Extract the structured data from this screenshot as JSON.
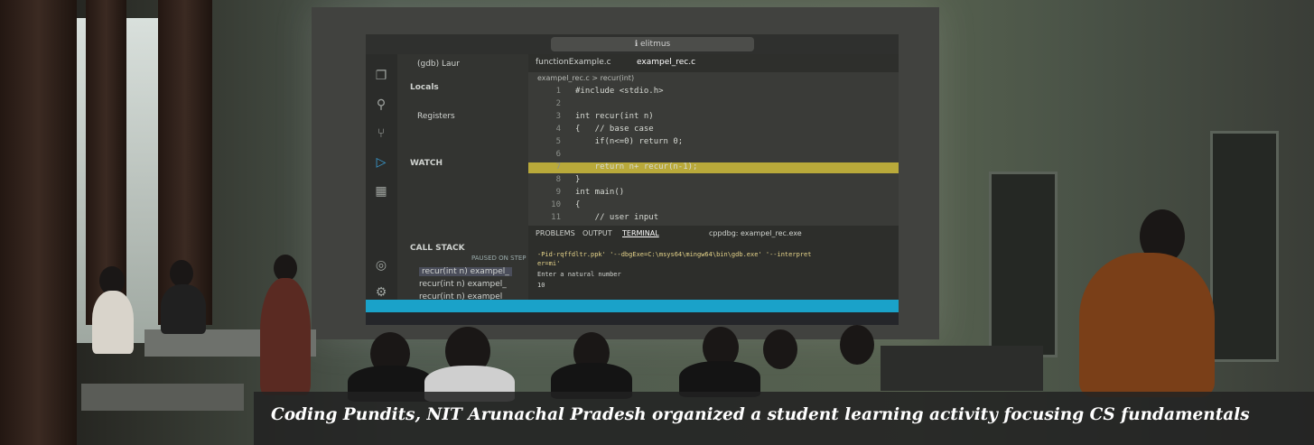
{
  "caption": "Coding Pundits, NIT Arunachal Pradesh organized a student learning activity focusing CS fundamentals",
  "projected_ide": {
    "search": "ℹ elitmus",
    "debug_config": "(gdb) Laur",
    "tabs": [
      "functionExample.c",
      "exampel_rec.c"
    ],
    "breadcrumb": "exampel_rec.c > recur(int)",
    "sidebar": {
      "locals": "Locals",
      "registers": "Registers",
      "watch": "WATCH",
      "call_stack": "CALL STACK",
      "paused": "PAUSED ON STEP",
      "frames": [
        "recur(int n)  exampel_",
        "recur(int n)  exampel_",
        "recur(int n)  exampel"
      ]
    },
    "code_lines": [
      {
        "n": "1",
        "t": "#include <stdio.h>"
      },
      {
        "n": "2",
        "t": ""
      },
      {
        "n": "3",
        "t": "int recur(int n)"
      },
      {
        "n": "4",
        "t": "{   // base case"
      },
      {
        "n": "5",
        "t": "    if(n<=0) return 0;"
      },
      {
        "n": "6",
        "t": ""
      },
      {
        "n": "7",
        "t": "    return n+ recur(n-1);"
      },
      {
        "n": "8",
        "t": "}"
      },
      {
        "n": "9",
        "t": "int main()"
      },
      {
        "n": "10",
        "t": "{"
      },
      {
        "n": "11",
        "t": "    // user input"
      }
    ],
    "panel_tabs": [
      "PROBLEMS",
      "OUTPUT",
      "TERMINAL"
    ],
    "terminal_task": "cppdbg: exampel_rec.exe",
    "terminal_lines": [
      "-Pid-rqffdltr.ppk' '--dbgExe=C:\\msys64\\mingw64\\bin\\gdb.exe' '--interpret",
      "er=mi'",
      "Enter a natural number",
      " 10"
    ]
  }
}
